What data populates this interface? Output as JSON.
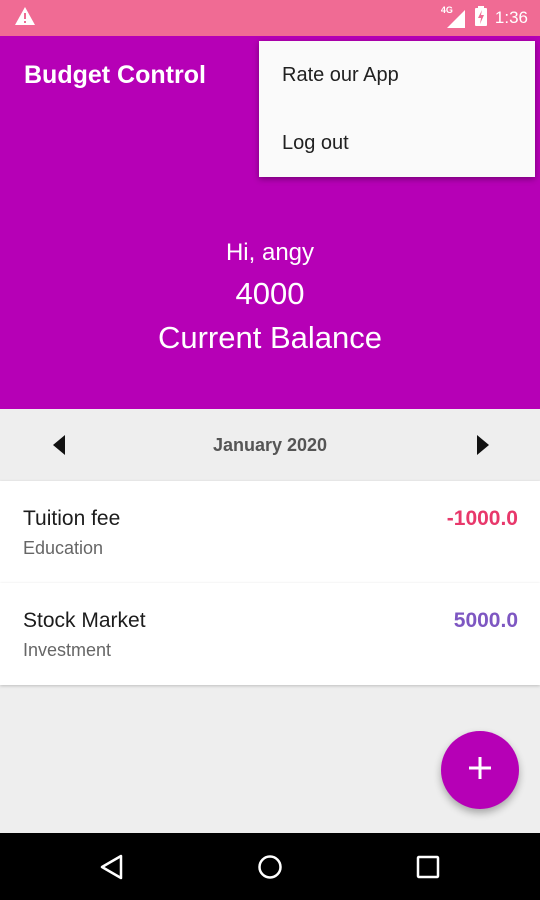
{
  "status_bar": {
    "time": "1:36",
    "network_label": "4G",
    "icons": [
      "warning-icon",
      "signal-icon",
      "battery-charging-icon"
    ],
    "background": "#f06b94"
  },
  "header": {
    "app_title": "Budget Control",
    "background": "#b600b6"
  },
  "summary": {
    "greeting": "Hi, angy",
    "balance": "4000",
    "balance_label": "Current Balance"
  },
  "overflow_menu": {
    "items": [
      {
        "label": "Rate our App"
      },
      {
        "label": "Log out"
      }
    ]
  },
  "month_nav": {
    "label": "January 2020",
    "prev_icon": "arrow-left-icon",
    "next_icon": "arrow-right-icon"
  },
  "transactions": [
    {
      "title": "Tuition fee",
      "category": "Education",
      "amount": "-1000.0",
      "amount_color": "#e8386b"
    },
    {
      "title": "Stock Market",
      "category": "Investment",
      "amount": "5000.0",
      "amount_color": "#7e57c2"
    }
  ],
  "fab": {
    "icon": "plus-icon",
    "color": "#b600b6"
  },
  "system_nav": {
    "icons": [
      "back-icon",
      "home-icon",
      "recents-icon"
    ]
  }
}
